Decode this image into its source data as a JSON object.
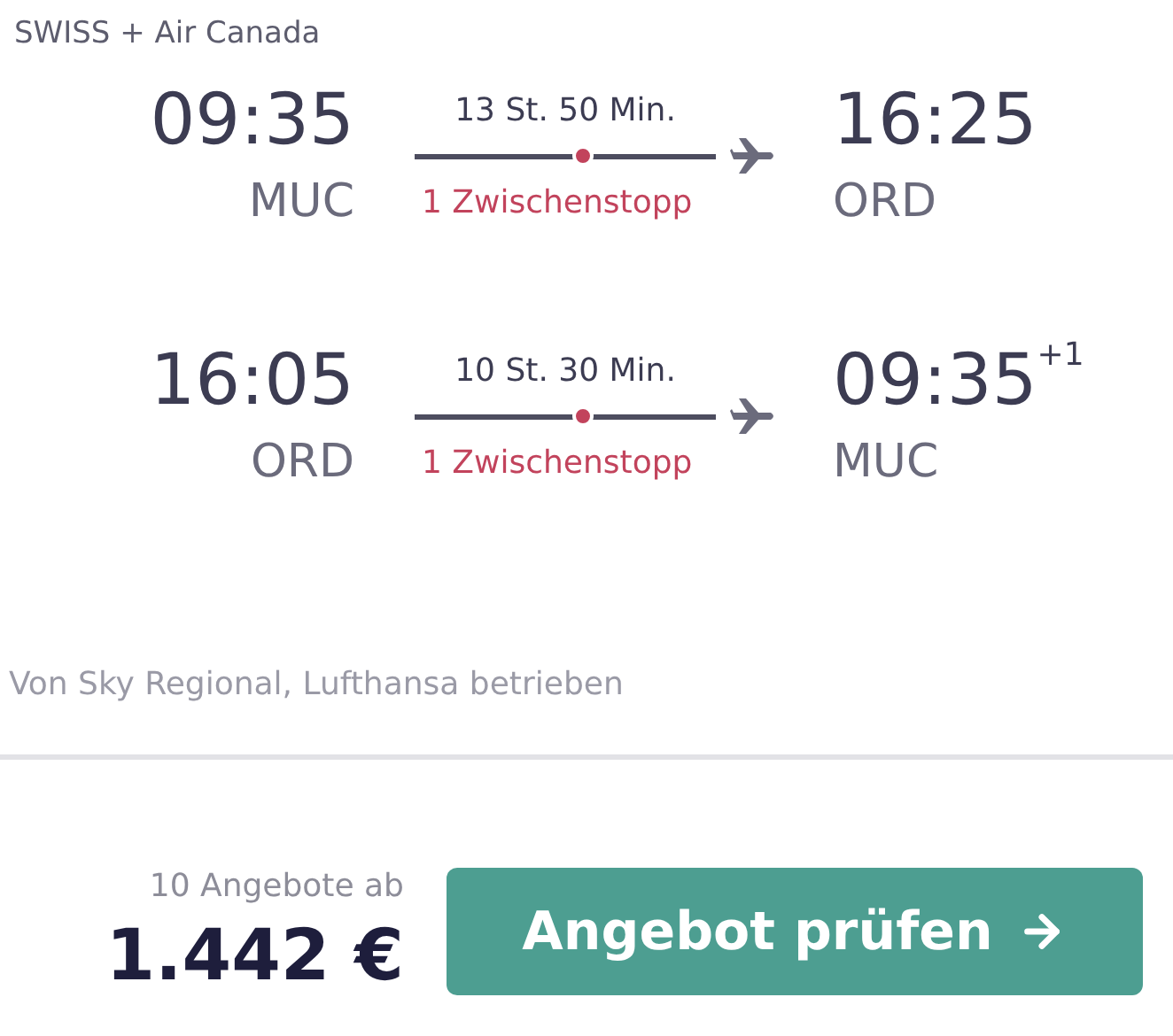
{
  "airlines": "SWISS + Air Canada",
  "legs": [
    {
      "departure_time": "09:35",
      "departure_airport": "MUC",
      "duration": "13 St. 50 Min.",
      "stops": "1 Zwischenstopp",
      "arrival_time": "16:25",
      "arrival_airport": "ORD"
    },
    {
      "departure_time": "16:05",
      "departure_airport": "ORD",
      "duration": "10 St. 30 Min.",
      "stops": "1 Zwischenstopp",
      "arrival_time": "09:35",
      "day_offset": "+1",
      "arrival_airport": "MUC"
    }
  ],
  "operated_by": "Von Sky Regional, Lufthansa betrieben",
  "offers": "10 Angebote ab",
  "price": "1.442 €",
  "button": "Angebot prüfen"
}
